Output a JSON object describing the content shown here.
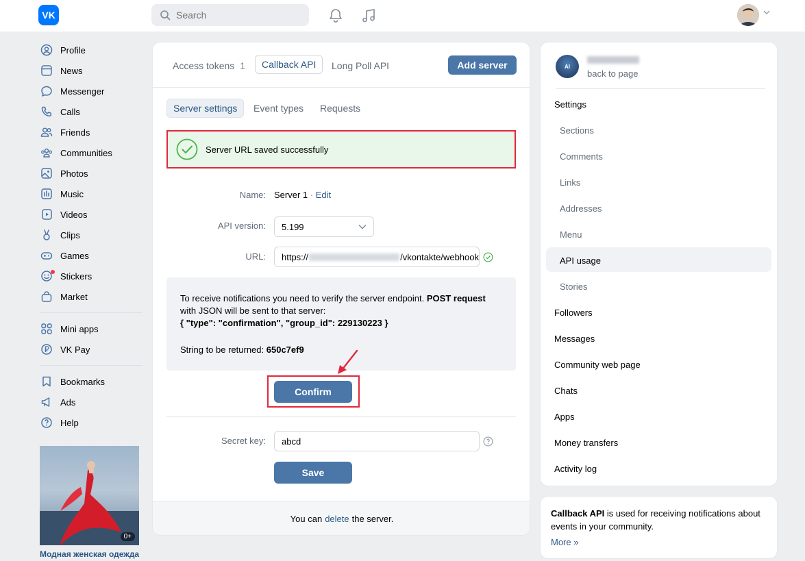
{
  "topbar": {
    "logo_text": "VK",
    "search_placeholder": "Search"
  },
  "nav": {
    "group1": [
      "Profile",
      "News",
      "Messenger",
      "Calls",
      "Friends",
      "Communities",
      "Photos",
      "Music",
      "Videos",
      "Clips",
      "Games",
      "Stickers",
      "Market"
    ],
    "group2": [
      "Mini apps",
      "VK Pay"
    ],
    "group3": [
      "Bookmarks",
      "Ads",
      "Help"
    ]
  },
  "ad": {
    "age_badge": "0+",
    "caption": "Модная женская одежда"
  },
  "main": {
    "tabs": {
      "access_tokens": "Access tokens",
      "access_tokens_count": "1",
      "callback_api": "Callback API",
      "long_poll_api": "Long Poll API"
    },
    "add_server_label": "Add server",
    "subtabs": {
      "server_settings": "Server settings",
      "event_types": "Event types",
      "requests": "Requests"
    },
    "success_message": "Server URL saved successfully",
    "form": {
      "name_label": "Name:",
      "name_value": "Server 1",
      "name_sep": " · ",
      "edit_link": "Edit",
      "api_version_label": "API version:",
      "api_version_value": "5.199",
      "url_label": "URL:",
      "url_prefix": "https://",
      "url_suffix": "/vkontakte/webhook",
      "secret_key_label": "Secret key:",
      "secret_key_value": "abcd"
    },
    "verify": {
      "text1": "To receive notifications you need to verify the server endpoint. ",
      "text_bold": "POST request",
      "text2": " with JSON will be sent to that server:",
      "json_line": "{ \"type\": \"confirmation\", \"group_id\": 229130223 }",
      "return_label": "String to be returned: ",
      "return_value": "650c7ef9"
    },
    "confirm_label": "Confirm",
    "save_label": "Save",
    "footer": {
      "prefix": "You can",
      "link": "delete",
      "suffix": "the server."
    }
  },
  "right": {
    "back_label": "back to page",
    "settings": "Settings",
    "sub_items": [
      "Sections",
      "Comments",
      "Links",
      "Addresses",
      "Menu",
      "API usage",
      "Stories"
    ],
    "items": [
      "Followers",
      "Messages",
      "Community web page",
      "Chats",
      "Apps",
      "Money transfers",
      "Activity log"
    ]
  },
  "info_card": {
    "bold": "Callback API",
    "text": " is used for receiving notifications about events in your community.",
    "more": "More »"
  },
  "colors": {
    "accent": "#4a76a8",
    "link": "#2a5885",
    "highlight": "#e0283b",
    "success_bg": "#e8f7e9",
    "success_icon": "#4bb34b"
  }
}
